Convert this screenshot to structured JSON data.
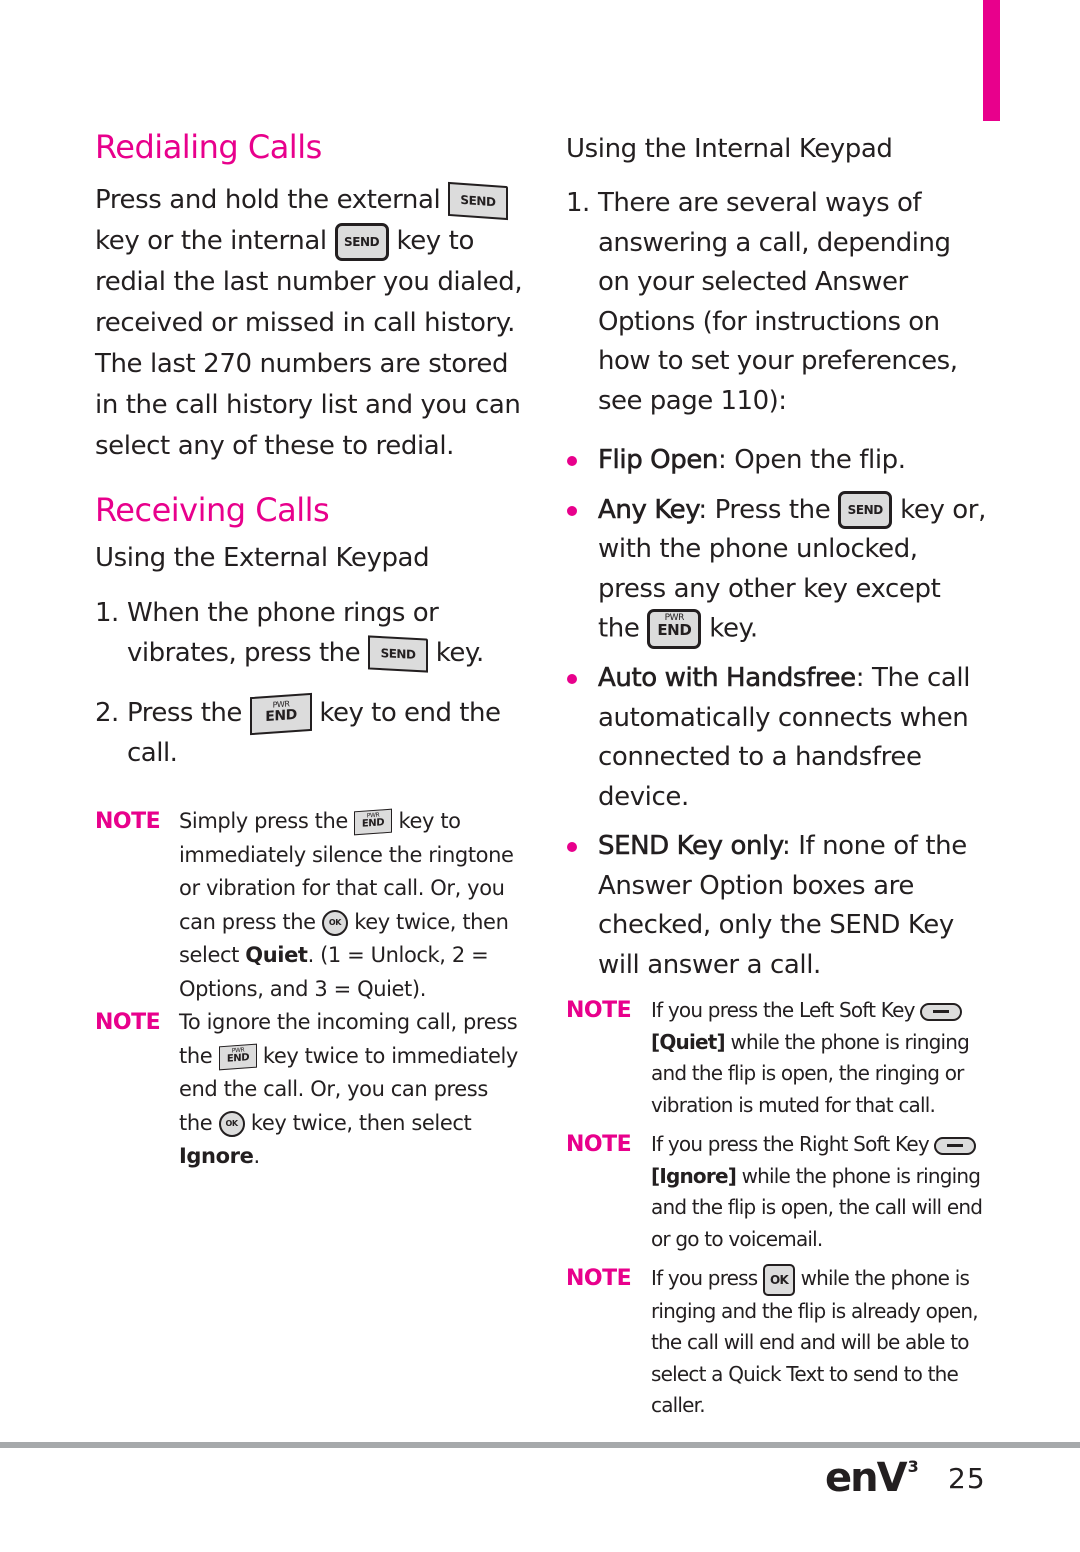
{
  "left": {
    "redialing": {
      "title": "Redialing Calls",
      "p1": "Press and hold the external",
      "p2": "key or the internal",
      "p3": "key to",
      "p4": "redial the last number you dialed, received or missed in call history. The last 270 numbers are stored in the call history list and you can select any of these to redial."
    },
    "receiving": {
      "title": "Receiving Calls",
      "subtitle": "Using the External Keypad",
      "steps": [
        {
          "num": "1.",
          "a": "When the phone rings or vibrates, press the",
          "b": "key."
        },
        {
          "num": "2.",
          "a": "Press the",
          "b": "key to end the call."
        }
      ],
      "notes": [
        {
          "label": "NOTE",
          "a": "Simply press the",
          "b": "key to immediately silence the ringtone or vibration for that call. Or, you can press the",
          "c": "key twice, then select",
          "bold": "Quiet",
          "d": ". (1 = Unlock, 2 = Options, and 3 = Quiet)."
        },
        {
          "label": "NOTE",
          "a": "To ignore the incoming call, press the",
          "b": "key twice to immediately end the call.  Or, you can press the",
          "c": "key twice, then select",
          "bold": "Ignore",
          "d": "."
        }
      ]
    }
  },
  "right": {
    "subtitle": "Using the Internal Keypad",
    "step": {
      "num": "1.",
      "text": "There are several ways of answering a call, depending on your selected Answer Options (for instructions on how to set your preferences, see page 110):"
    },
    "bullets": [
      {
        "term": "Flip Open",
        "text": ": Open the flip."
      },
      {
        "term": "Any Key",
        "a": ": Press the",
        "b": "key or, with the phone unlocked, press any other key except the",
        "c": "key."
      },
      {
        "term": "Auto with Handsfree",
        "text": ": The call automatically connects when connected to a handsfree device."
      },
      {
        "term": "SEND Key only",
        "text": ": If none of the Answer Option boxes are checked, only the SEND Key will answer a call."
      }
    ],
    "notes": [
      {
        "label": "NOTE",
        "a": "If you press the Left Soft Key",
        "bold": "[Quiet]",
        "b": "while the phone is ringing and the flip is open, the ringing or vibration is muted for that call."
      },
      {
        "label": "NOTE",
        "a": "If you press the Right Soft Key",
        "bold": "[Ignore]",
        "b": "while the phone is ringing and the flip is open, the call will end or go to voicemail."
      },
      {
        "label": "NOTE",
        "a": "If you press",
        "b": "while the phone is ringing and the flip is already open, the call will end and will be able to select a Quick Text to send to the caller."
      }
    ]
  },
  "keys": {
    "send": "SEND",
    "pwr": "PWR",
    "end": "END",
    "ok": "OK"
  },
  "footer": {
    "brand": "enV",
    "brand_sup": "3",
    "page_number": "25"
  },
  "colors": {
    "accent": "#e8008c",
    "text": "#231f20",
    "rule": "#a6a9ab"
  }
}
